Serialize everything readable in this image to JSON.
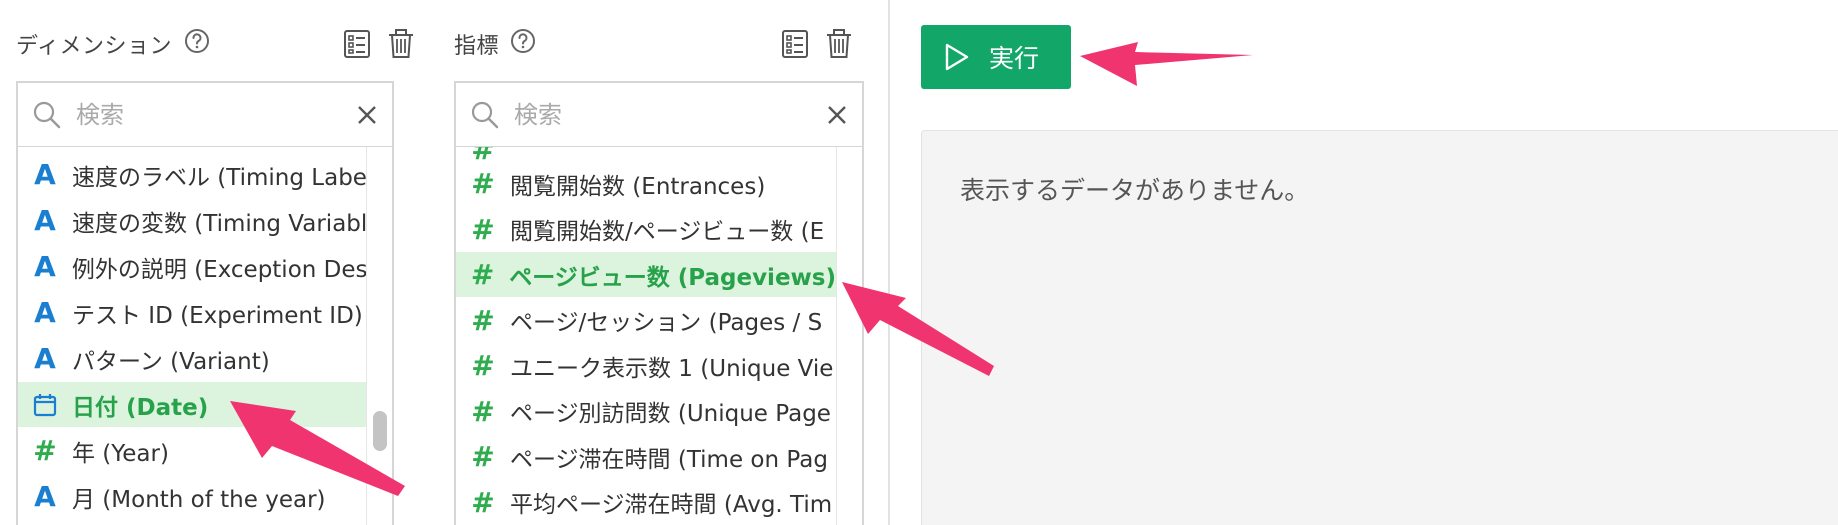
{
  "dimensions": {
    "title": "ディメンション",
    "search_placeholder": "検索",
    "items": [
      {
        "icon": "text-type-icon",
        "label": "速度のラベル (Timing Label)"
      },
      {
        "icon": "text-type-icon",
        "label": "速度の変数 (Timing Variable)"
      },
      {
        "icon": "text-type-icon",
        "label": "例外の説明 (Exception Descri"
      },
      {
        "icon": "text-type-icon",
        "label": "テスト ID (Experiment ID)"
      },
      {
        "icon": "text-type-icon",
        "label": "パターン (Variant)"
      },
      {
        "icon": "calendar-icon",
        "label": "日付 (Date)",
        "selected": true
      },
      {
        "icon": "number-type-icon",
        "label": "年 (Year)"
      },
      {
        "icon": "text-type-icon",
        "label": "月 (Month of the year)"
      }
    ]
  },
  "metrics": {
    "title": "指標",
    "search_placeholder": "検索",
    "items": [
      {
        "icon": "number-type-icon",
        "label": "閲覧開始数 (Entrances)"
      },
      {
        "icon": "number-type-icon",
        "label": "閲覧開始数/ページビュー数 (E"
      },
      {
        "icon": "number-type-icon",
        "label": "ページビュー数 (Pageviews)",
        "selected": true
      },
      {
        "icon": "number-type-icon",
        "label": "ページ/セッション (Pages / S"
      },
      {
        "icon": "number-type-icon",
        "label": "ユニーク表示数 1 (Unique Vie"
      },
      {
        "icon": "number-type-icon",
        "label": "ページ別訪問数 (Unique Page"
      },
      {
        "icon": "number-type-icon",
        "label": "ページ滞在時間 (Time on Pag"
      },
      {
        "icon": "number-type-icon",
        "label": "平均ページ滞在時間 (Avg. Tim"
      }
    ]
  },
  "run_button": {
    "label": "実行",
    "icon": "play-icon"
  },
  "result": {
    "empty_message": "表示するデータがありません。"
  },
  "colors": {
    "accent_green": "#12a668",
    "selected_bg": "#dcf3de",
    "selected_text": "#27a24a",
    "text_icon": "#1a7fd1",
    "number_icon": "#2fad4e",
    "annotation_arrow": "#f0346f"
  }
}
